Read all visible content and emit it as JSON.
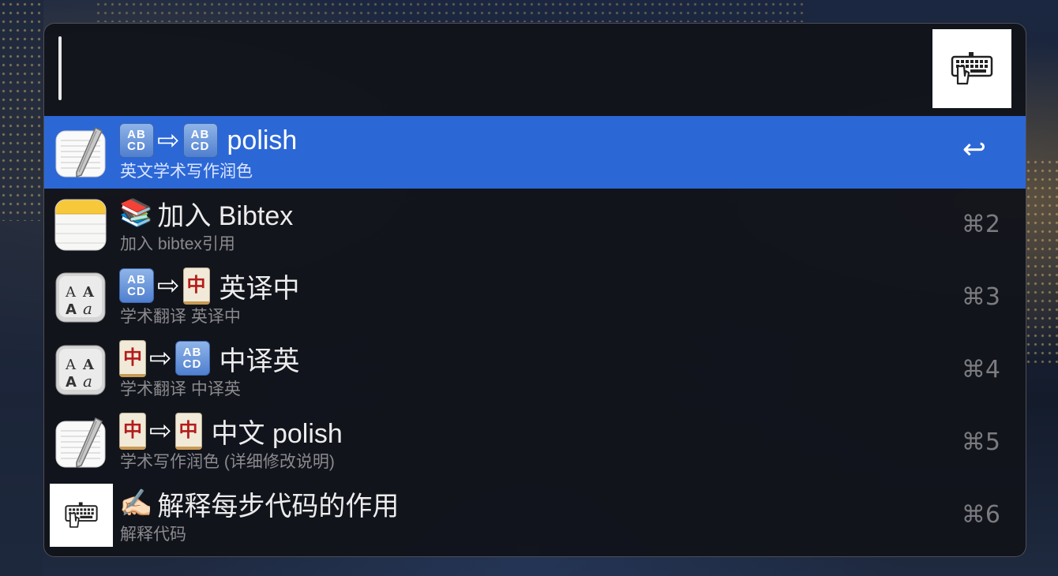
{
  "search": {
    "query": "",
    "hotkey_icon": "keyboard-hand-icon"
  },
  "results": [
    {
      "title": "polish",
      "subtitle": "英文学术写作润色",
      "shortcut": "↩",
      "icon": "textedit-icon",
      "prefix": [
        "abcd",
        "arrow",
        "abcd"
      ]
    },
    {
      "title": "加入 Bibtex",
      "subtitle": "加入 bibtex引用",
      "shortcut": "⌘2",
      "icon": "notes-icon",
      "prefix": [
        "books"
      ]
    },
    {
      "title": "英译中",
      "subtitle": "学术翻译 英译中",
      "shortcut": "⌘3",
      "icon": "font-book-icon",
      "prefix": [
        "abcd",
        "arrow",
        "mahjong"
      ]
    },
    {
      "title": "中译英",
      "subtitle": "学术翻译 中译英",
      "shortcut": "⌘4",
      "icon": "font-book-icon",
      "prefix": [
        "mahjong",
        "arrow",
        "abcd"
      ]
    },
    {
      "title": "中文 polish",
      "subtitle": "学术写作润色 (详细修改说明)",
      "shortcut": "⌘5",
      "icon": "textedit-icon",
      "prefix": [
        "mahjong",
        "arrow",
        "mahjong"
      ]
    },
    {
      "title": "解释每步代码的作用",
      "subtitle": "解释代码",
      "shortcut": "⌘6",
      "icon": "keyboard-hand-icon",
      "prefix": [
        "writing-hand"
      ]
    }
  ],
  "glyphs": {
    "abcd_top": "AB",
    "abcd_bottom": "CD",
    "mahjong": "中",
    "arrow": "⇨",
    "books": "📚",
    "writing_hand": "✍🏻"
  },
  "colors": {
    "selection": "#2c67d6",
    "panel_bg": "#12141b",
    "subtitle": "#8a8a8e",
    "shortcut": "#7b7b80"
  }
}
